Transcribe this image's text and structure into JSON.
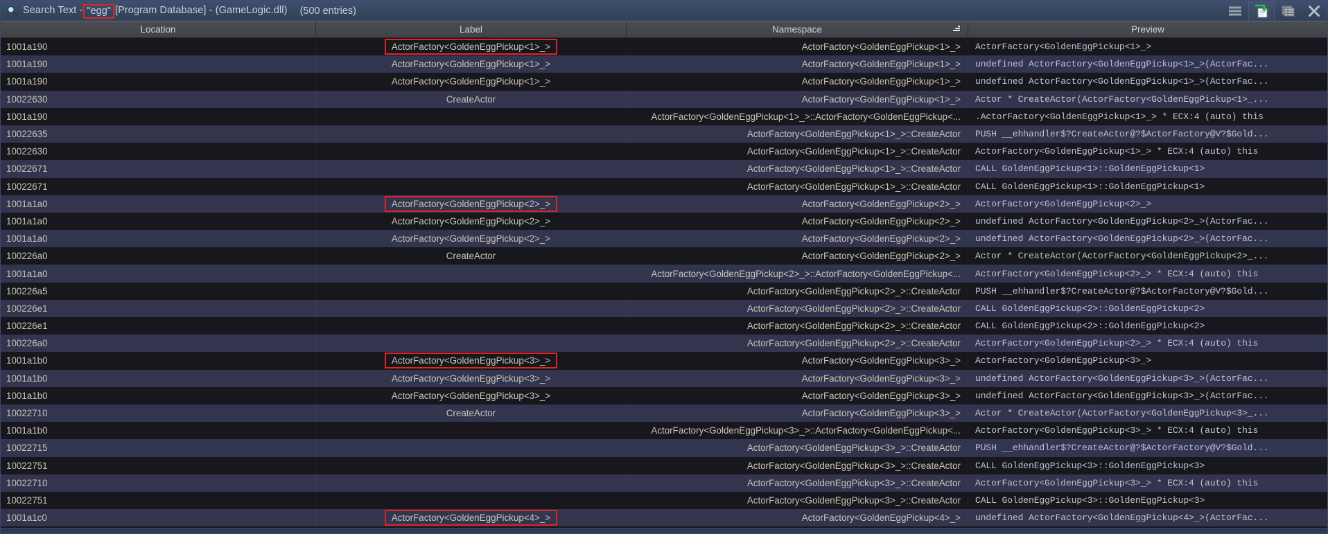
{
  "window": {
    "icon": "search-icon",
    "title_prefix": "Search Text - ",
    "search_term": "\"egg\"",
    "title_suffix": " [Program Database] - (GameLogic.dll)",
    "entries_count": "(500 entries)",
    "buttons": [
      {
        "name": "menu-button",
        "icon": "hamburger-menu-icon",
        "label": "Menu"
      },
      {
        "name": "export-button",
        "icon": "export-to-file-icon",
        "label": "Export"
      },
      {
        "name": "snapshot-button",
        "icon": "table-snapshot-icon",
        "label": "Snapshot"
      },
      {
        "name": "close-button",
        "icon": "close-icon",
        "label": "Close"
      }
    ]
  },
  "colors": {
    "titlebar": "#36465f",
    "header": "#46484d",
    "row_even": "#17171d",
    "row_odd": "#33344e",
    "text": "#c6c6b8",
    "highlight_border": "#e02424",
    "window_frame": "#2b3a52"
  },
  "table": {
    "columns": [
      {
        "key": "location",
        "label": "Location",
        "sorted": false
      },
      {
        "key": "label",
        "label": "Label",
        "sorted": false
      },
      {
        "key": "namespace",
        "label": "Namespace",
        "sorted": true,
        "sort_icon": "sort-descending-icon"
      },
      {
        "key": "preview",
        "label": "Preview",
        "sorted": false
      }
    ],
    "rows": [
      {
        "location": "1001a190",
        "label": "ActorFactory<GoldenEggPickup<1>_>",
        "label_highlighted": true,
        "namespace": "ActorFactory<GoldenEggPickup<1>_>",
        "preview": "ActorFactory<GoldenEggPickup<1>_>"
      },
      {
        "location": "1001a190",
        "label": "ActorFactory<GoldenEggPickup<1>_>",
        "label_highlighted": false,
        "namespace": "ActorFactory<GoldenEggPickup<1>_>",
        "preview": "undefined ActorFactory<GoldenEggPickup<1>_>(ActorFac..."
      },
      {
        "location": "1001a190",
        "label": "ActorFactory<GoldenEggPickup<1>_>",
        "label_highlighted": false,
        "namespace": "ActorFactory<GoldenEggPickup<1>_>",
        "preview": "undefined ActorFactory<GoldenEggPickup<1>_>(ActorFac..."
      },
      {
        "location": "10022630",
        "label": "CreateActor",
        "label_highlighted": false,
        "namespace": "ActorFactory<GoldenEggPickup<1>_>",
        "preview": "Actor * CreateActor(ActorFactory<GoldenEggPickup<1>_..."
      },
      {
        "location": "1001a190",
        "label": "",
        "label_highlighted": false,
        "namespace": "ActorFactory<GoldenEggPickup<1>_>::ActorFactory<GoldenEggPickup<...",
        "preview": ".ActorFactory<GoldenEggPickup<1>_> * ECX:4 (auto) this"
      },
      {
        "location": "10022635",
        "label": "",
        "label_highlighted": false,
        "namespace": "ActorFactory<GoldenEggPickup<1>_>::CreateActor",
        "preview": "PUSH __ehhandler$?CreateActor@?$ActorFactory@V?$Gold..."
      },
      {
        "location": "10022630",
        "label": "",
        "label_highlighted": false,
        "namespace": "ActorFactory<GoldenEggPickup<1>_>::CreateActor",
        "preview": "ActorFactory<GoldenEggPickup<1>_> * ECX:4 (auto) this"
      },
      {
        "location": "10022671",
        "label": "",
        "label_highlighted": false,
        "namespace": "ActorFactory<GoldenEggPickup<1>_>::CreateActor",
        "preview": "CALL GoldenEggPickup<1>::GoldenEggPickup<1>"
      },
      {
        "location": "10022671",
        "label": "",
        "label_highlighted": false,
        "namespace": "ActorFactory<GoldenEggPickup<1>_>::CreateActor",
        "preview": "CALL GoldenEggPickup<1>::GoldenEggPickup<1>"
      },
      {
        "location": "1001a1a0",
        "label": "ActorFactory<GoldenEggPickup<2>_>",
        "label_highlighted": true,
        "namespace": "ActorFactory<GoldenEggPickup<2>_>",
        "preview": "ActorFactory<GoldenEggPickup<2>_>"
      },
      {
        "location": "1001a1a0",
        "label": "ActorFactory<GoldenEggPickup<2>_>",
        "label_highlighted": false,
        "namespace": "ActorFactory<GoldenEggPickup<2>_>",
        "preview": "undefined ActorFactory<GoldenEggPickup<2>_>(ActorFac..."
      },
      {
        "location": "1001a1a0",
        "label": "ActorFactory<GoldenEggPickup<2>_>",
        "label_highlighted": false,
        "namespace": "ActorFactory<GoldenEggPickup<2>_>",
        "preview": "undefined ActorFactory<GoldenEggPickup<2>_>(ActorFac..."
      },
      {
        "location": "100226a0",
        "label": "CreateActor",
        "label_highlighted": false,
        "namespace": "ActorFactory<GoldenEggPickup<2>_>",
        "preview": "Actor * CreateActor(ActorFactory<GoldenEggPickup<2>_..."
      },
      {
        "location": "1001a1a0",
        "label": "",
        "label_highlighted": false,
        "namespace": "ActorFactory<GoldenEggPickup<2>_>::ActorFactory<GoldenEggPickup<...",
        "preview": "ActorFactory<GoldenEggPickup<2>_> * ECX:4 (auto) this"
      },
      {
        "location": "100226a5",
        "label": "",
        "label_highlighted": false,
        "namespace": "ActorFactory<GoldenEggPickup<2>_>::CreateActor",
        "preview": "PUSH __ehhandler$?CreateActor@?$ActorFactory@V?$Gold..."
      },
      {
        "location": "100226e1",
        "label": "",
        "label_highlighted": false,
        "namespace": "ActorFactory<GoldenEggPickup<2>_>::CreateActor",
        "preview": "CALL GoldenEggPickup<2>::GoldenEggPickup<2>"
      },
      {
        "location": "100226e1",
        "label": "",
        "label_highlighted": false,
        "namespace": "ActorFactory<GoldenEggPickup<2>_>::CreateActor",
        "preview": "CALL GoldenEggPickup<2>::GoldenEggPickup<2>"
      },
      {
        "location": "100226a0",
        "label": "",
        "label_highlighted": false,
        "namespace": "ActorFactory<GoldenEggPickup<2>_>::CreateActor",
        "preview": "ActorFactory<GoldenEggPickup<2>_> * ECX:4 (auto) this"
      },
      {
        "location": "1001a1b0",
        "label": "ActorFactory<GoldenEggPickup<3>_>",
        "label_highlighted": true,
        "namespace": "ActorFactory<GoldenEggPickup<3>_>",
        "preview": "ActorFactory<GoldenEggPickup<3>_>"
      },
      {
        "location": "1001a1b0",
        "label": "ActorFactory<GoldenEggPickup<3>_>",
        "label_highlighted": false,
        "namespace": "ActorFactory<GoldenEggPickup<3>_>",
        "preview": "undefined ActorFactory<GoldenEggPickup<3>_>(ActorFac..."
      },
      {
        "location": "1001a1b0",
        "label": "ActorFactory<GoldenEggPickup<3>_>",
        "label_highlighted": false,
        "namespace": "ActorFactory<GoldenEggPickup<3>_>",
        "preview": "undefined ActorFactory<GoldenEggPickup<3>_>(ActorFac..."
      },
      {
        "location": "10022710",
        "label": "CreateActor",
        "label_highlighted": false,
        "namespace": "ActorFactory<GoldenEggPickup<3>_>",
        "preview": "Actor * CreateActor(ActorFactory<GoldenEggPickup<3>_..."
      },
      {
        "location": "1001a1b0",
        "label": "",
        "label_highlighted": false,
        "namespace": "ActorFactory<GoldenEggPickup<3>_>::ActorFactory<GoldenEggPickup<...",
        "preview": "ActorFactory<GoldenEggPickup<3>_> * ECX:4 (auto) this"
      },
      {
        "location": "10022715",
        "label": "",
        "label_highlighted": false,
        "namespace": "ActorFactory<GoldenEggPickup<3>_>::CreateActor",
        "preview": "PUSH __ehhandler$?CreateActor@?$ActorFactory@V?$Gold..."
      },
      {
        "location": "10022751",
        "label": "",
        "label_highlighted": false,
        "namespace": "ActorFactory<GoldenEggPickup<3>_>::CreateActor",
        "preview": "CALL GoldenEggPickup<3>::GoldenEggPickup<3>"
      },
      {
        "location": "10022710",
        "label": "",
        "label_highlighted": false,
        "namespace": "ActorFactory<GoldenEggPickup<3>_>::CreateActor",
        "preview": "ActorFactory<GoldenEggPickup<3>_> * ECX:4 (auto) this"
      },
      {
        "location": "10022751",
        "label": "",
        "label_highlighted": false,
        "namespace": "ActorFactory<GoldenEggPickup<3>_>::CreateActor",
        "preview": "CALL GoldenEggPickup<3>::GoldenEggPickup<3>"
      },
      {
        "location": "1001a1c0",
        "label": "ActorFactory<GoldenEggPickup<4>_>",
        "label_highlighted": true,
        "namespace": "ActorFactory<GoldenEggPickup<4>_>",
        "preview": "undefined ActorFactory<GoldenEggPickup<4>_>(ActorFac..."
      }
    ]
  }
}
